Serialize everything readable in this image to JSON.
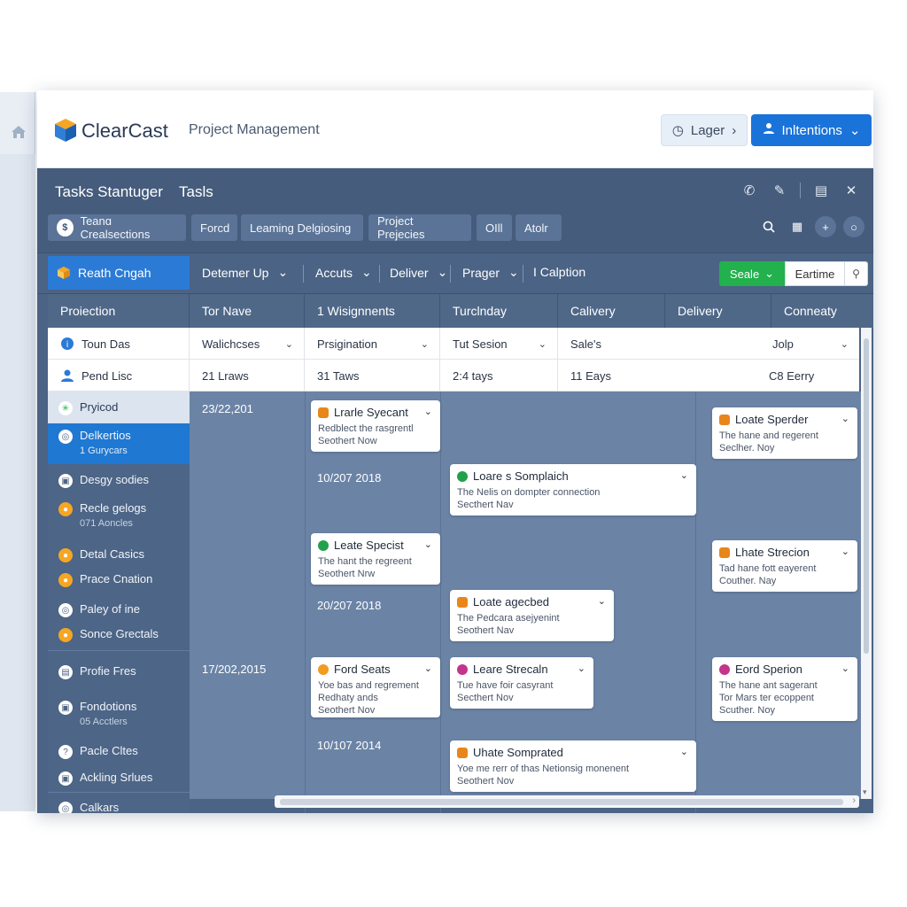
{
  "header": {
    "brand": "ClearCast",
    "subtitle": "Project Management",
    "lager_label": "Lager",
    "intentions_label": "Inltentions"
  },
  "titlebar": {
    "title": "Tasks Stantuger",
    "title2": "Tasls"
  },
  "tabs": [
    {
      "label": "Teanɑ Crealsections"
    },
    {
      "label": "Forcd"
    },
    {
      "label": "Leaming Delgiosing"
    },
    {
      "label": "Project Prejecies"
    },
    {
      "label": "OIll"
    },
    {
      "label": "Atolr"
    }
  ],
  "filters": {
    "reach": "Reath Cngah",
    "items": [
      "Detemer Up",
      "Accuts",
      "Deliver",
      "Prager",
      "I Calption"
    ],
    "seal": "Seale",
    "eartime": "Eartime"
  },
  "columns": [
    "Proiection",
    "Tor Nave",
    "1 Wisignnents",
    "Turclnday",
    "Calivery",
    "Delivery",
    "Conneaty"
  ],
  "rows": [
    {
      "label": "Toun Das",
      "c1": "Walichcses",
      "c2": "Prsigination",
      "c3": "Tut Sesion",
      "c4": "Sale's",
      "c5": "Jolp"
    },
    {
      "label": "Pend Lisc",
      "c1": "21 Lraws",
      "c2": "31 Taws",
      "c3": "2:4 tays",
      "c4": "11 Eays",
      "c5": "C8 Eerry"
    }
  ],
  "sidebar": [
    {
      "label": "Pryicod",
      "sub": ""
    },
    {
      "label": "Delkertios",
      "sub": "1 Gurycars"
    },
    {
      "label": "Desgy sodies",
      "sub": ""
    },
    {
      "label": "Recle gelogs",
      "sub": "071 Aoncles"
    },
    {
      "label": "Detal Casics",
      "sub": ""
    },
    {
      "label": "Prace Cnation",
      "sub": ""
    },
    {
      "label": "Paley of ine",
      "sub": ""
    },
    {
      "label": "Sonce Grectals",
      "sub": ""
    },
    {
      "label": "Profie Fres",
      "sub": ""
    },
    {
      "label": "Fondotions",
      "sub": "05 Acctlers"
    },
    {
      "label": "Pacle Cltes",
      "sub": ""
    },
    {
      "label": "Ackling Srlues",
      "sub": ""
    },
    {
      "label": "Calkars",
      "sub": ""
    }
  ],
  "dates": [
    "23/22,201",
    "10/207 2018",
    "20/207 2018",
    "17/202,2015",
    "10/107 2014"
  ],
  "cards": [
    {
      "title": "Lrarle Syecant",
      "line1": "Redblect the rasgrentl",
      "line2": "Seothert Now",
      "color": "#e8861a"
    },
    {
      "title": "Leate Specist",
      "line1": "The hant the regreent",
      "line2": "Seothert Nrw",
      "color": "#23a04a"
    },
    {
      "title": "Ford Seats",
      "line1": "Yoe bas and regrement",
      "line2": "Redhaty ands",
      "line3": "Seothert Nov",
      "color": "#f29b1e"
    },
    {
      "title": "Loare s Somplaich",
      "line1": "The Nelis on dompter connection",
      "line2": "Secthert Nav",
      "color": "#23a04a"
    },
    {
      "title": "Loate agecbed",
      "line1": "The Pedcara asejyenint",
      "line2": "Seothert Nav",
      "color": "#e8861a"
    },
    {
      "title": "Leare Strecaln",
      "line1": "Tue have foir casyrant",
      "line2": "Secthert Nov",
      "color": "#c2358a"
    },
    {
      "title": "Uhate Somprated",
      "line1": "Yoe me rerr of thas Netionsig monenent",
      "line2": "Seothert Nov",
      "color": "#e8861a"
    },
    {
      "title": "Loate Sperder",
      "line1": "The hane and regerent",
      "line2": "Seclher. Noy",
      "color": "#e8861a"
    },
    {
      "title": "Lhate Strecion",
      "line1": "Tad hane fott eayerent",
      "line2": "Couther. Nay",
      "color": "#e8861a"
    },
    {
      "title": "Eord Sperion",
      "line1": "The hane ant sagerant",
      "line2": "Tor Mars ter ecoppent",
      "line3": "Scuther. Noy",
      "color": "#c2358a"
    }
  ]
}
